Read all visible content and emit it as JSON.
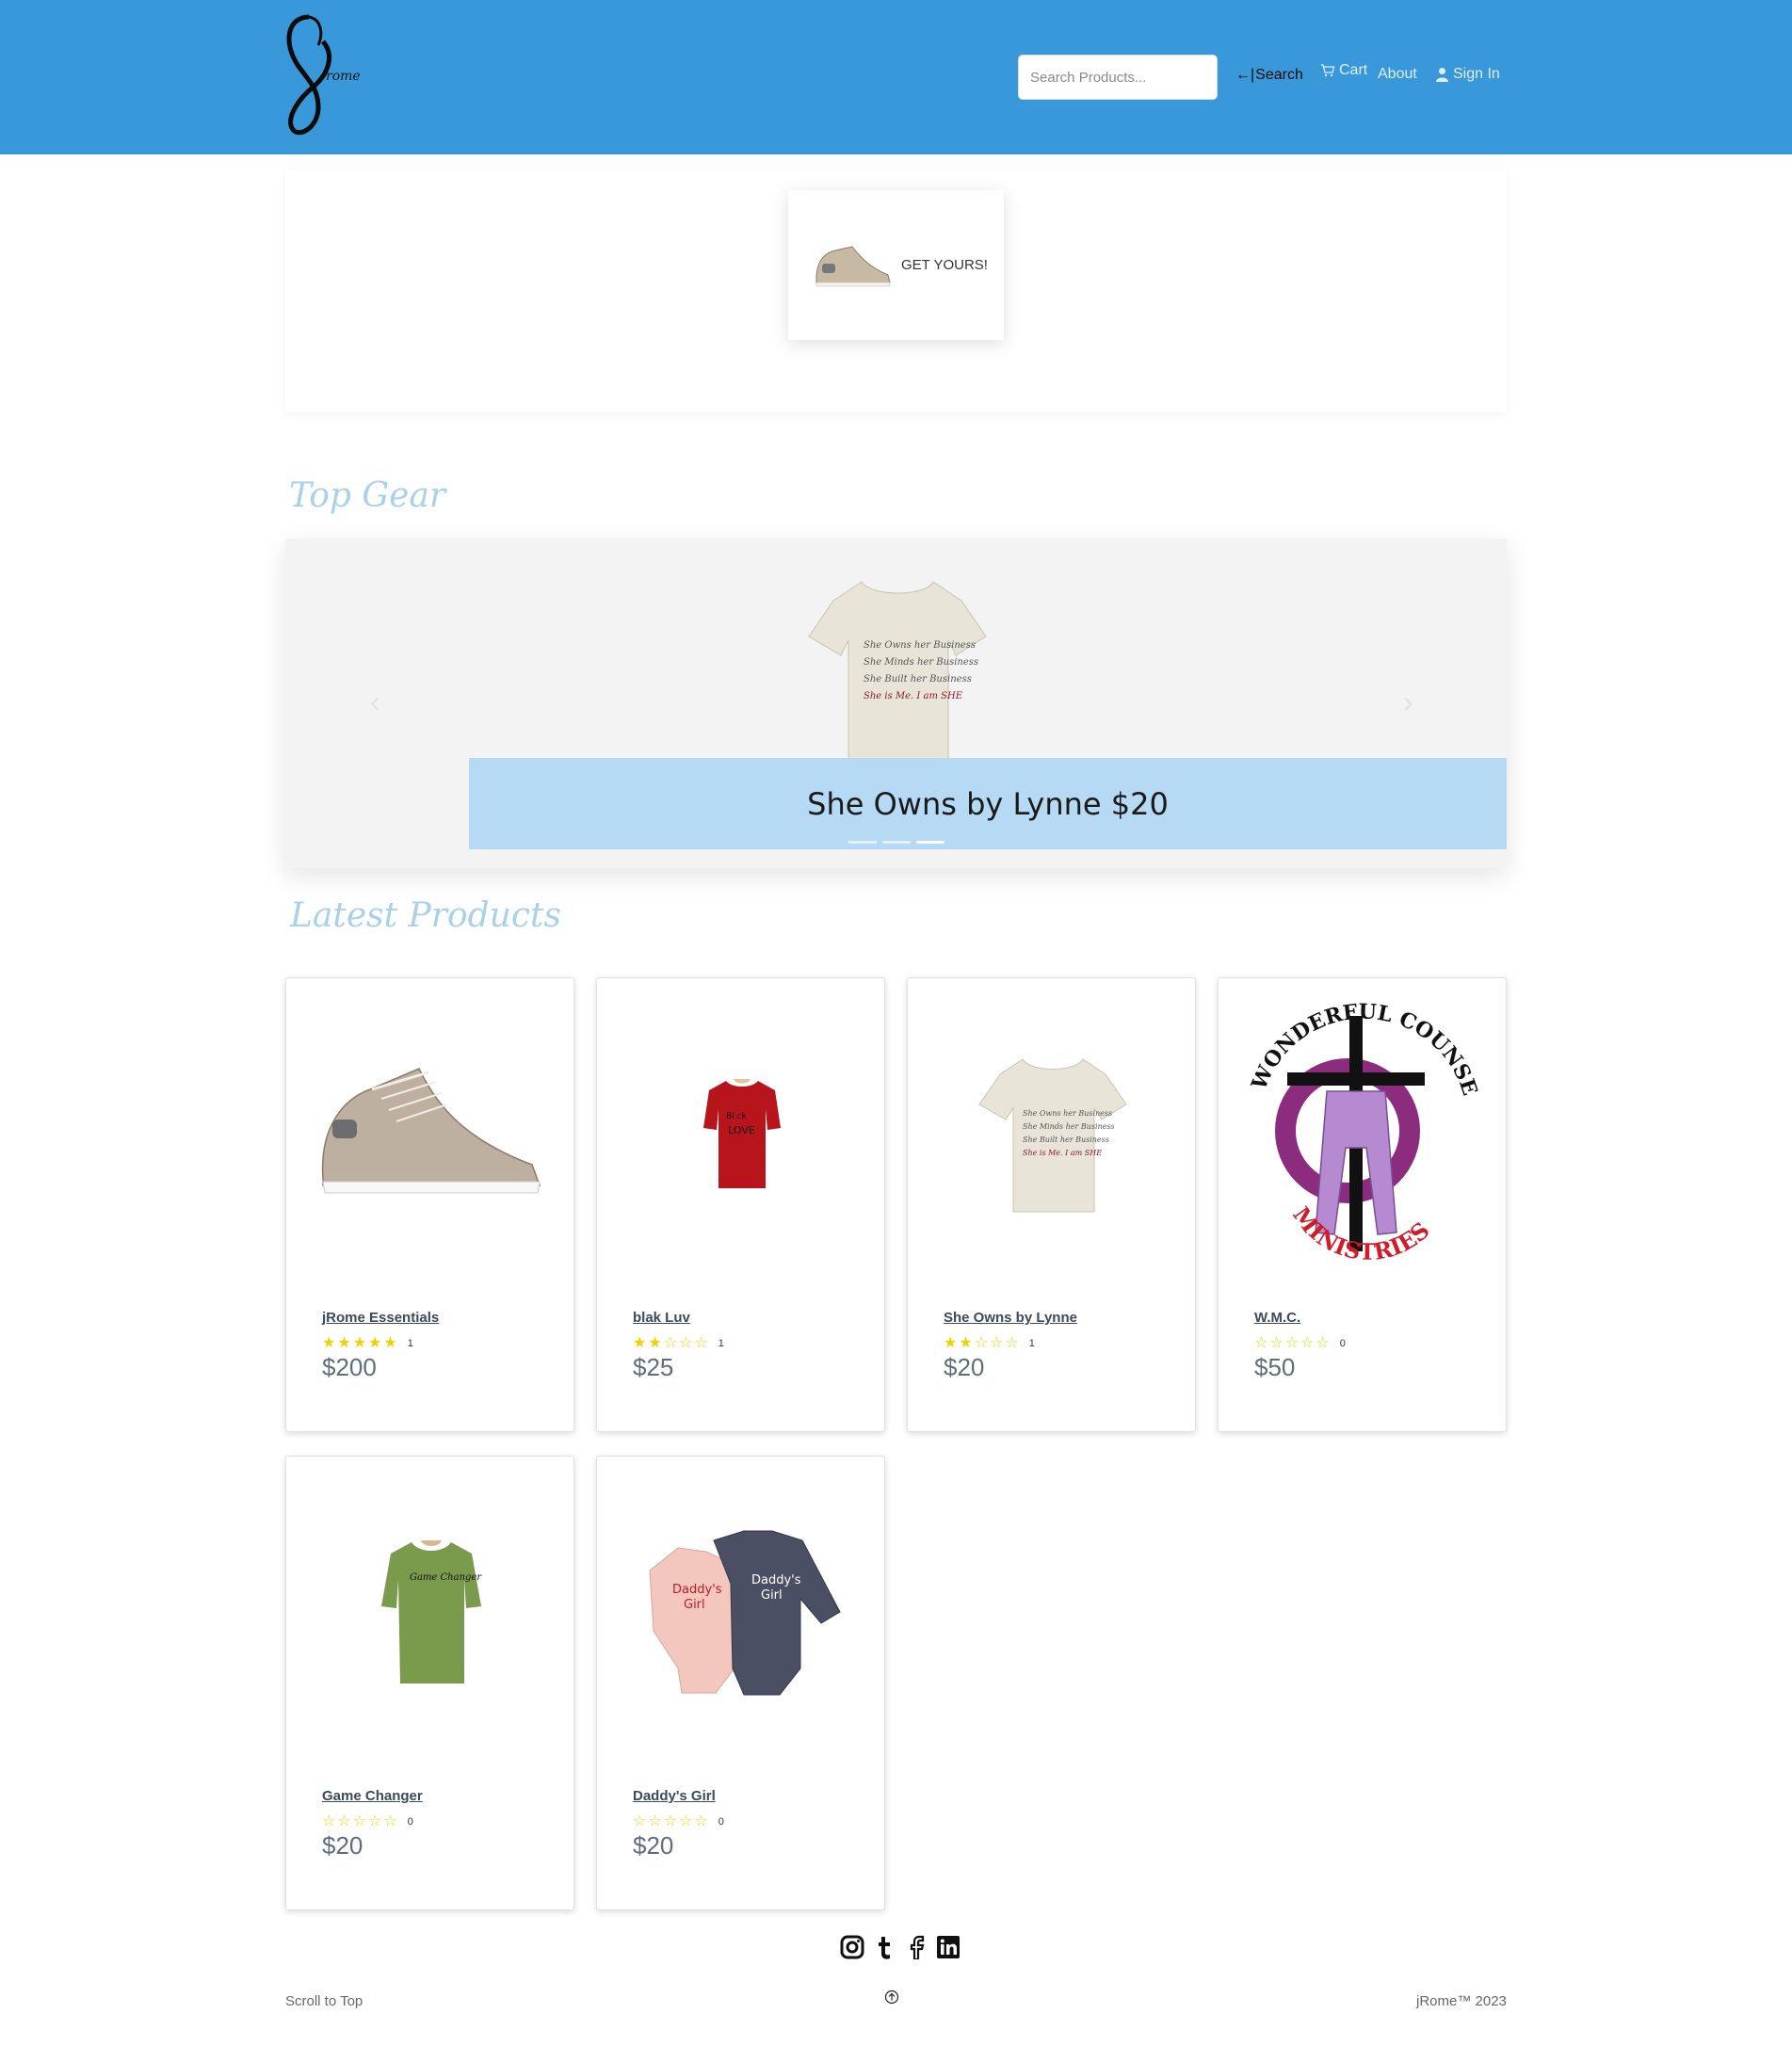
{
  "header": {
    "logo_text": "rome",
    "search_placeholder": "Search Products...",
    "search_button": "Search",
    "nav": {
      "cart": "Cart",
      "about": "About",
      "sign_in": "Sign In"
    }
  },
  "promo": {
    "cta": "GET YOURS!"
  },
  "sections": {
    "top_gear": "Top Gear",
    "latest": "Latest Products"
  },
  "carousel": {
    "caption": "She Owns by Lynne $20",
    "slide_count": 3,
    "active_slide": 3
  },
  "products": [
    {
      "name": "jRome Essentials",
      "rating": 5,
      "reviews": "1",
      "price": "$200"
    },
    {
      "name": "blak Luv",
      "rating": 2,
      "reviews": "1",
      "price": "$25"
    },
    {
      "name": "She Owns by Lynne",
      "rating": 2,
      "reviews": "1",
      "price": "$20"
    },
    {
      "name": "W.M.C.",
      "rating": 0,
      "reviews": "0",
      "price": "$50"
    },
    {
      "name": "Game Changer",
      "rating": 0,
      "reviews": "0",
      "price": "$20"
    },
    {
      "name": "Daddy's Girl",
      "rating": 0,
      "reviews": "0",
      "price": "$20"
    }
  ],
  "footer": {
    "scroll_top": "Scroll to Top",
    "copyright": "jRome™ 2023"
  },
  "colors": {
    "header_bg": "#3998d9",
    "caption_bg": "#b6daf3",
    "section_title": "#a9d2ea",
    "star": "#f1d100"
  }
}
